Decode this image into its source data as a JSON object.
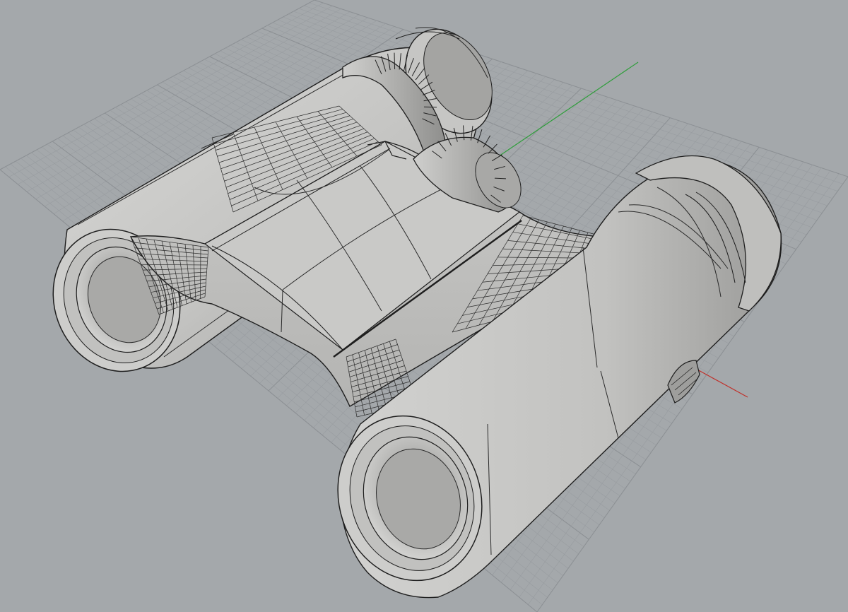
{
  "viewport": {
    "view_style": "shaded-wireframe",
    "projection": "perspective",
    "model": "binoculars",
    "grid_visible": true,
    "colors": {
      "background": "#a4a8ab",
      "grid_minor": "#989ca0",
      "grid_major": "#8b8f93",
      "x_axis": "#c0302a",
      "y_axis": "#2f9e3b",
      "surface_light": "#d4d4d2",
      "surface_mid": "#b9b9b7",
      "surface_dark": "#8e8e8c",
      "edge": "#1e1e1e"
    }
  }
}
